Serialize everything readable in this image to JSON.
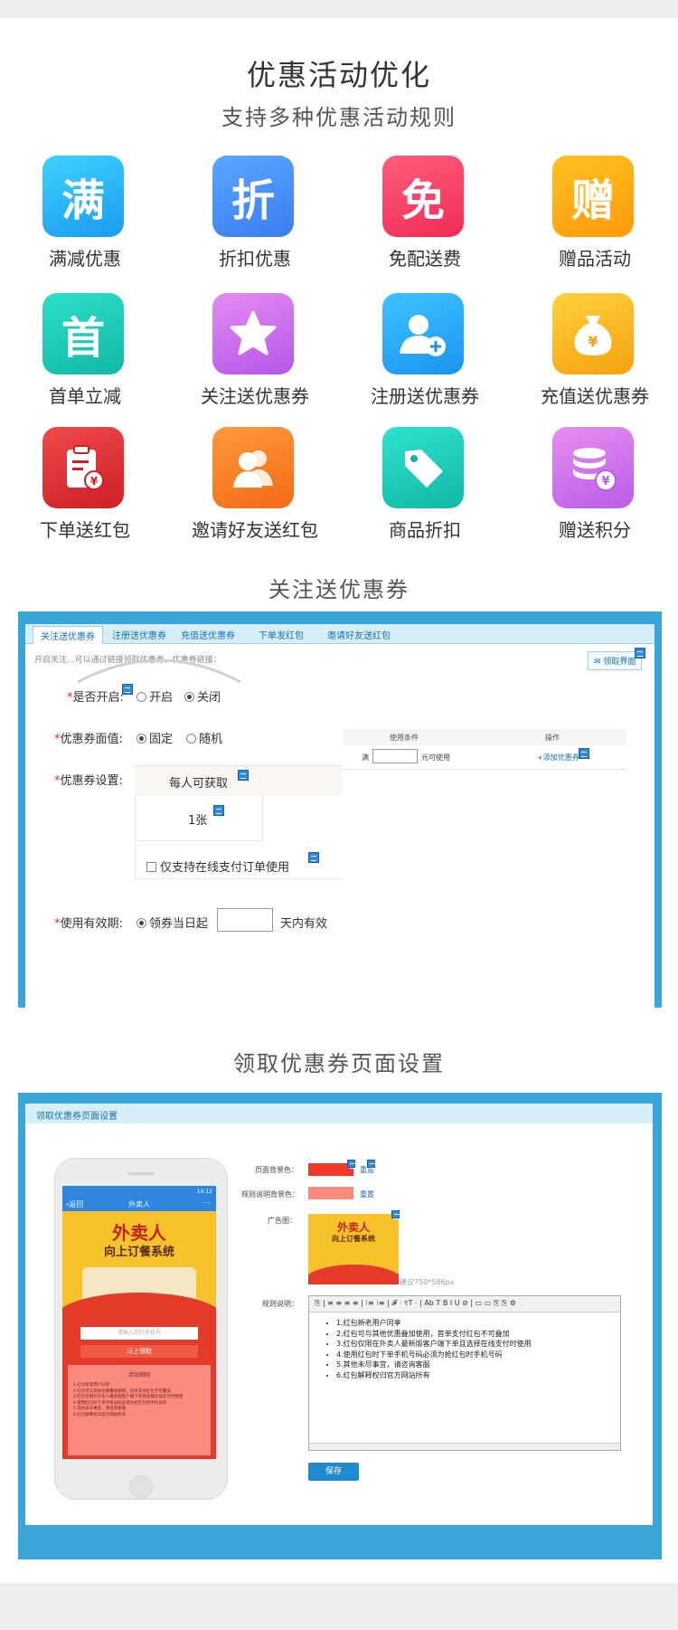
{
  "header": {
    "title": "优惠活动优化",
    "subtitle": "支持多种优惠活动规则"
  },
  "features": [
    {
      "label": "满减优惠",
      "glyph": "满",
      "icon": "man-jian-icon",
      "color_from": "#3ed1ff",
      "color_to": "#1a9cf0"
    },
    {
      "label": "折扣优惠",
      "glyph": "折",
      "icon": "zhe-kou-icon",
      "color_from": "#5aa7ff",
      "color_to": "#3b7cf0"
    },
    {
      "label": "免配送费",
      "glyph": "免",
      "icon": "mian-pei-icon",
      "color_from": "#ff5d7c",
      "color_to": "#f02c55"
    },
    {
      "label": "赠品活动",
      "glyph": "赠",
      "icon": "zeng-pin-icon",
      "color_from": "#ffc21f",
      "color_to": "#ff9a0c"
    },
    {
      "label": "首单立减",
      "glyph": "首",
      "icon": "shou-dan-icon",
      "color_from": "#2de0c8",
      "color_to": "#12b7a8"
    },
    {
      "label": "关注送优惠券",
      "glyph": "",
      "icon": "star-icon",
      "color_from": "#e58bf2",
      "color_to": "#b656e8"
    },
    {
      "label": "注册送优惠券",
      "glyph": "",
      "icon": "add-user-icon",
      "color_from": "#3fc3ff",
      "color_to": "#1a94ef"
    },
    {
      "label": "充值送优惠券",
      "glyph": "",
      "icon": "money-bag-icon",
      "color_from": "#ffd23d",
      "color_to": "#f5a10f"
    },
    {
      "label": "下单送红包",
      "glyph": "",
      "icon": "clipboard-yuan-icon",
      "color_from": "#f04a4a",
      "color_to": "#cc1f26"
    },
    {
      "label": "邀请好友送红包",
      "glyph": "",
      "icon": "friends-icon",
      "color_from": "#ff9a3c",
      "color_to": "#f26a15"
    },
    {
      "label": "商品折扣",
      "glyph": "",
      "icon": "price-tag-icon",
      "color_from": "#2ee3cf",
      "color_to": "#11b7a6"
    },
    {
      "label": "赠送积分",
      "glyph": "",
      "icon": "coins-yuan-icon",
      "color_from": "#e88df1",
      "color_to": "#b95de6"
    }
  ],
  "section1": {
    "title": "关注送优惠券",
    "tabs": [
      "关注送优惠券",
      "注册送优惠券",
      "充值送优惠券",
      "下单发红包",
      "邀请好友送红包"
    ],
    "hint": "开启关注...可以通过链接领取优惠券，优惠券链接：",
    "page_button": "领取界面",
    "form": {
      "enable_label": "是否开启:",
      "enable_options": [
        "开启",
        "关闭"
      ],
      "enable_selected": "关闭",
      "value_label": "优惠券面值:",
      "value_options": [
        "固定",
        "随机"
      ],
      "value_selected": "固定",
      "setting_label": "优惠券设置:",
      "per_person": "每人可获取",
      "count": "1张",
      "online_only": "仅支持在线支付订单使用",
      "validity_label": "使用有效期:",
      "validity_option": "领券当日起",
      "validity_suffix": "天内有效"
    },
    "table": {
      "col_condition": "使用条件",
      "col_action": "操作",
      "prefix": "满",
      "suffix": "元可使用",
      "add_link": "+添加优惠券"
    }
  },
  "section2": {
    "title": "领取优惠券页面设置",
    "header": "领取优惠券页面设置",
    "phone": {
      "back": "返回",
      "title": "外卖人",
      "status": "14:12",
      "banner_line1": "外卖人",
      "banner_line2": "向上订餐系统",
      "phone_placeholder": "请输入您的手机号",
      "claim_button": "马上领取",
      "rules_title": "活动规则",
      "rules": [
        "1.红包新老用户同享",
        "2.红包可与其他优惠叠加使用，首单支付红包不可叠加",
        "3.红包仅限在外卖人最新版客户端下单且选择在线支付时使用",
        "4.使用红包时下单手机号码必须为抢红包时手机号码",
        "5.其他未尽事宜，请咨询客服",
        "6.红包解释权归官方网站所有"
      ]
    },
    "bg_label": "页面背景色：",
    "bg_color": "#f0382a",
    "rule_bg_label": "规则说明背景色：",
    "rule_bg_color": "#fb8a7f",
    "reset": "重置",
    "ad_label": "广告图：",
    "ad_hint": "建议750*586px",
    "rule_label": "规则说明：",
    "toolbar": "⎘ | ≡ ≡ ≡ ≡ | ⁝≡ ⁝≡ | 𝓕 · τT · | Ab T B I U ⊘ | ▭ ▭ ⎘ ⎘ ⚙",
    "save": "保存"
  }
}
